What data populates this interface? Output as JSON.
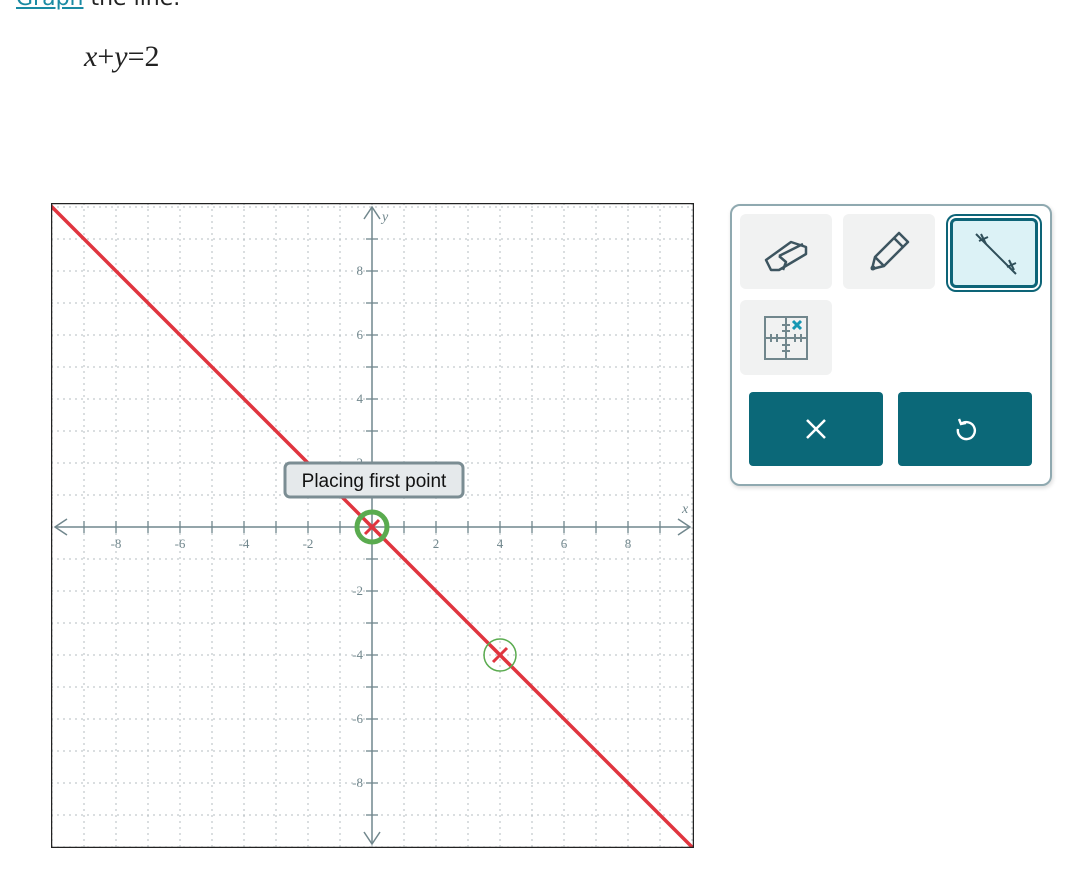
{
  "prompt": {
    "link": "Graph",
    "rest": " the line."
  },
  "equation": {
    "lhs_x": "x",
    "plus": "+",
    "lhs_y": "y",
    "eq": "=",
    "rhs": "2"
  },
  "graph": {
    "x_axis_label": "x",
    "y_axis_label": "y",
    "x_range": [
      -10,
      10
    ],
    "y_range": [
      -10,
      10
    ],
    "x_tick_labels": [
      "-8",
      "-6",
      "-4",
      "-2",
      "2",
      "4",
      "6",
      "8"
    ],
    "y_tick_labels": [
      "8",
      "6",
      "4",
      "2",
      "-2",
      "-4",
      "-6",
      "-8"
    ],
    "grid": true,
    "drawn_line": {
      "through": [
        [
          0,
          0
        ],
        [
          4,
          -4
        ]
      ],
      "color": "#e0353f"
    },
    "points": [
      {
        "x": 0,
        "y": 0,
        "active": true
      },
      {
        "x": 4,
        "y": -4,
        "active": false
      }
    ],
    "point_ring_color": "#5aab4f",
    "tooltip": "Placing first point"
  },
  "toolbar": {
    "tools": [
      {
        "name": "eraser-icon"
      },
      {
        "name": "pencil-icon"
      },
      {
        "name": "line-tool-icon",
        "selected": true
      },
      {
        "name": "point-plot-icon"
      }
    ],
    "clear_icon": "close-icon",
    "undo_icon": "undo-icon",
    "accent": "#0b6878"
  }
}
